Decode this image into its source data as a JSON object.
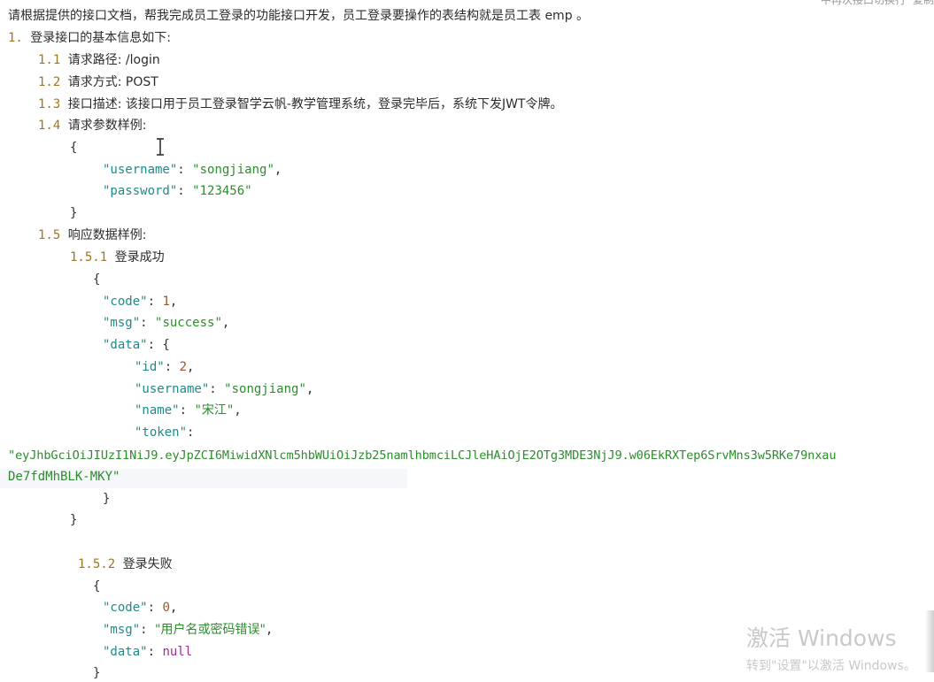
{
  "topbar": {
    "left_text": "中再次接口切换行",
    "right_text": "复制"
  },
  "intro": "请根据提供的接口文档，帮我完成员工登录的功能接口开发，员工登录要操作的表结构就是员工表 emp 。",
  "section1": {
    "num": "1.",
    "title": "登录接口的基本信息如下:",
    "items": [
      {
        "num": "1.1",
        "text": "请求路径: /login"
      },
      {
        "num": "1.2",
        "text": "请求方式: POST"
      },
      {
        "num": "1.3",
        "text": "接口描述: 该接口用于员工登录智学云帆-教学管理系统，登录完毕后，系统下发JWT令牌。"
      },
      {
        "num": "1.4",
        "text": "请求参数样例:"
      }
    ]
  },
  "request": {
    "username_key": "\"username\"",
    "username_val": "\"songjiang\"",
    "password_key": "\"password\"",
    "password_val": "\"123456\""
  },
  "section15": {
    "num": "1.5",
    "text": "响应数据样例:"
  },
  "success": {
    "num": "1.5.1",
    "title": "登录成功",
    "code_key": "\"code\"",
    "code_val": "1",
    "msg_key": "\"msg\"",
    "msg_val": "\"success\"",
    "data_key": "\"data\"",
    "id_key": "\"id\"",
    "id_val": "2",
    "username_key": "\"username\"",
    "username_val": "\"songjiang\"",
    "name_key": "\"name\"",
    "name_val": "\"宋江\"",
    "token_key": "\"token\"",
    "token_line1": "\"eyJhbGciOiJIUzI1NiJ9.eyJpZCI6MiwidXNlcm5hbWUiOiJzb25namlhbmciLCJleHAiOjE2OTg3MDE3NjJ9.w06EkRXTep6SrvMns3w5RKe79nxau",
    "token_line2": "De7fdMhBLK-MKY\""
  },
  "failure": {
    "num": "1.5.2",
    "title": "登录失败",
    "code_key": "\"code\"",
    "code_val": "0",
    "msg_key": "\"msg\"",
    "msg_val": "\"用户名或密码错误\"",
    "data_key": "\"data\"",
    "data_val": "null"
  },
  "watermark": {
    "line1": "激活 Windows",
    "line2": "转到\"设置\"以激活 Windows。"
  }
}
